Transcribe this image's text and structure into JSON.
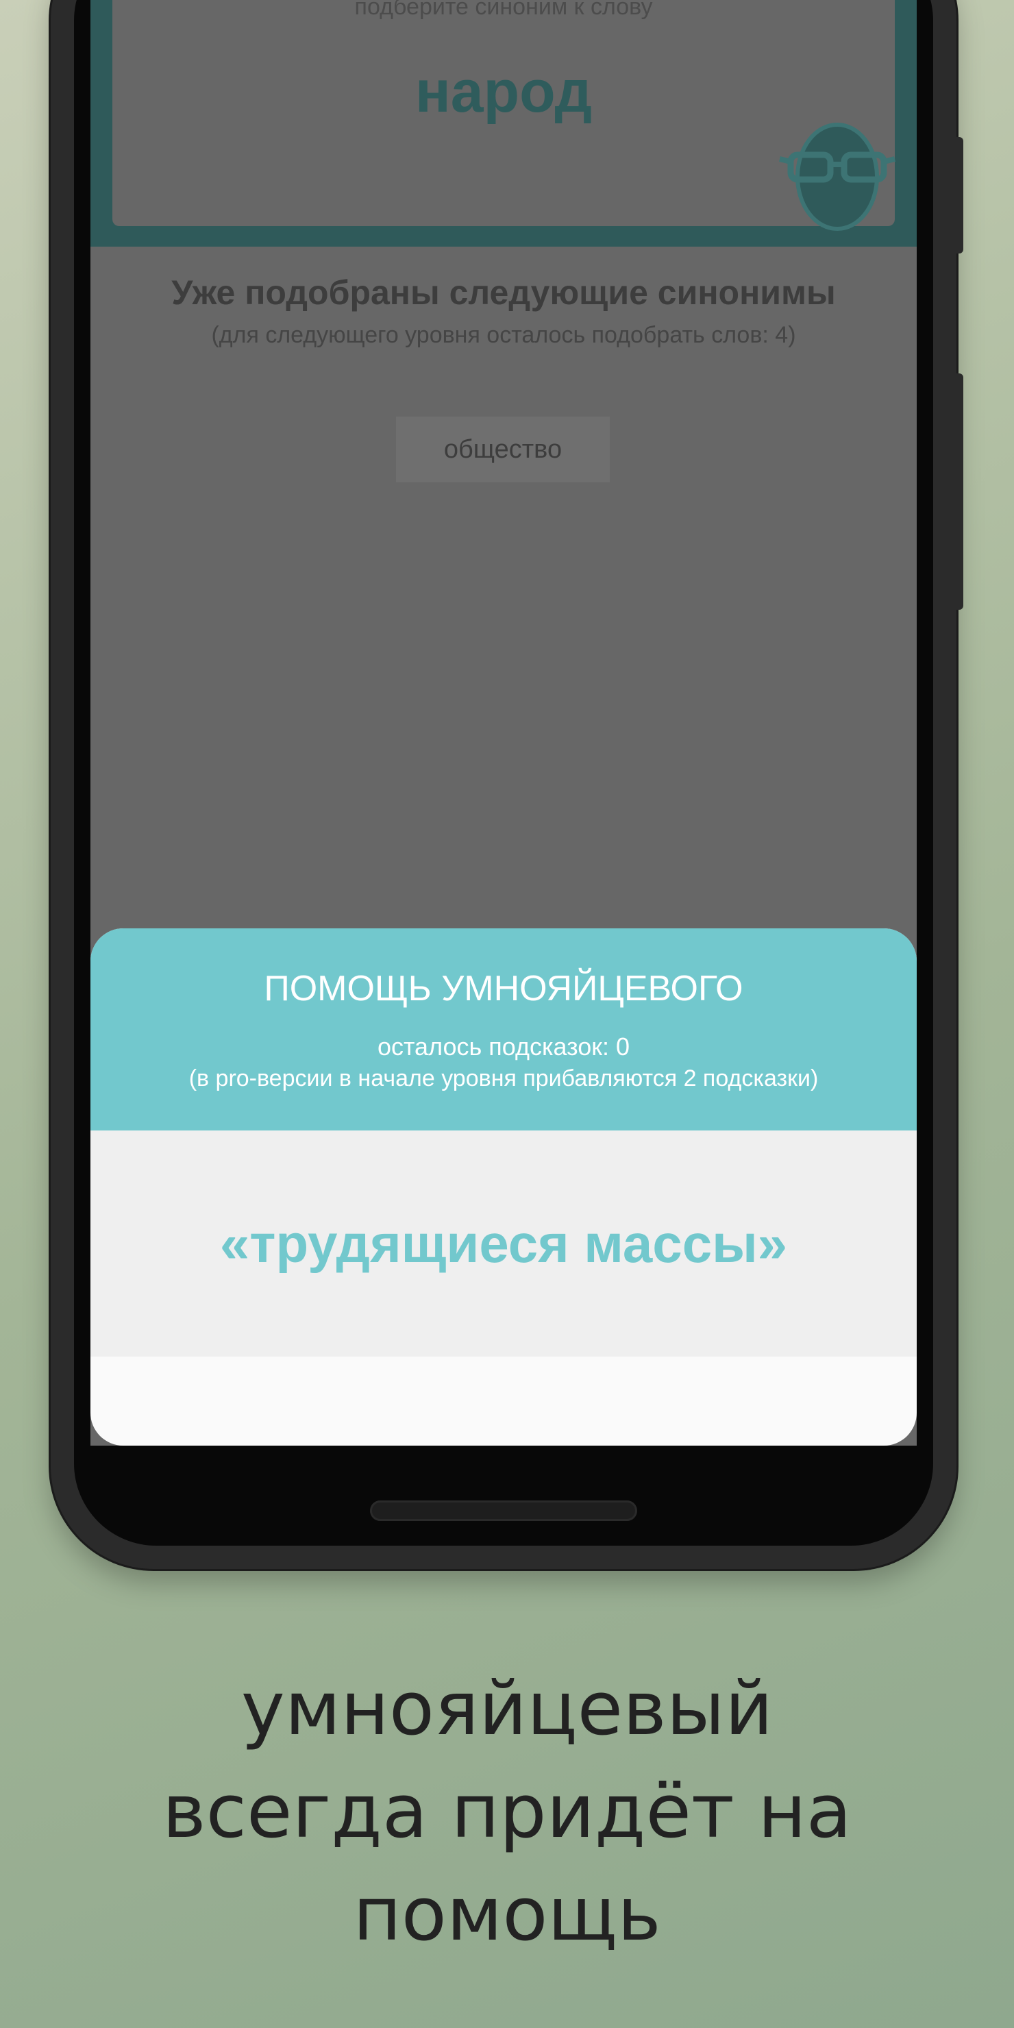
{
  "game": {
    "prompt": "подберите синоним к слову",
    "word": "народ",
    "found_title": "Уже подобраны следующие синонимы",
    "found_subtitle": "(для следующего уровня осталось подобрать слов: 4)",
    "found_synonyms": [
      "общество"
    ],
    "mascot_icon": "egg-with-glasses-icon"
  },
  "dialog": {
    "title": "ПОМОЩЬ УМНОЯЙЦЕВОГО",
    "hints_left": "осталось подсказок: 0",
    "pro_note": "(в pro-версии в начале уровня прибавляются 2 подсказки)",
    "hint": "«трудящиеся массы»"
  },
  "caption": {
    "lines": [
      "умнояйцевый",
      "всегда придёт на",
      "помощь"
    ]
  },
  "colors": {
    "accent": "#72c8cd",
    "dark_teal": "#2f5a5a",
    "dim_overlay": "#676767"
  }
}
